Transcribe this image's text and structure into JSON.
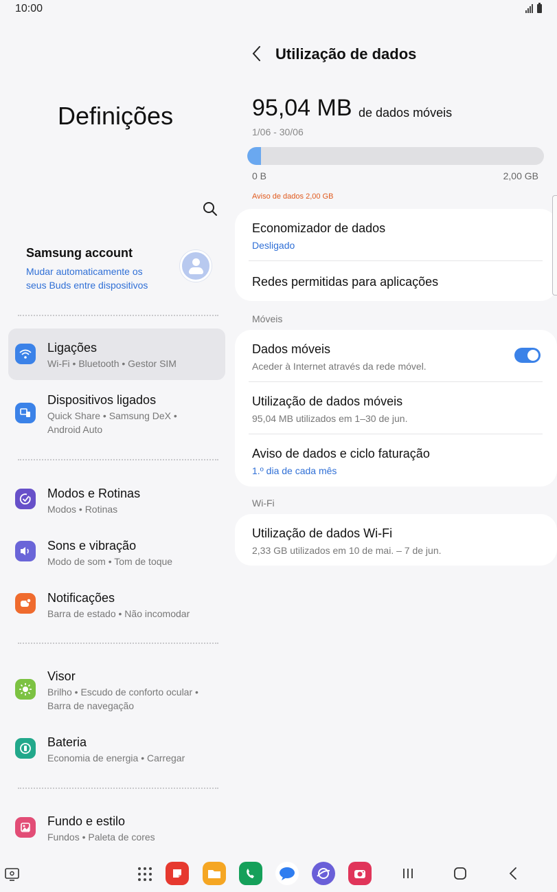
{
  "status": {
    "time": "10:00"
  },
  "left": {
    "title": "Definições",
    "account": {
      "name": "Samsung account",
      "subtitle": "Mudar automaticamente os seus Buds entre dispositivos"
    },
    "items": [
      {
        "label": "Ligações",
        "sub": "Wi-Fi • Bluetooth • Gestor SIM",
        "icon": "wifi-icon",
        "color": "#3b82e8"
      },
      {
        "label": "Dispositivos ligados",
        "sub": "Quick Share • Samsung DeX • Android Auto",
        "icon": "devices-icon",
        "color": "#3b82e8"
      },
      {
        "label": "Modos e Rotinas",
        "sub": "Modos • Rotinas",
        "icon": "check-circle-icon",
        "color": "#6750c9"
      },
      {
        "label": "Sons e vibração",
        "sub": "Modo de som • Tom de toque",
        "icon": "speaker-icon",
        "color": "#6a65d8"
      },
      {
        "label": "Notificações",
        "sub": "Barra de estado • Não incomodar",
        "icon": "notification-icon",
        "color": "#ef6b2e"
      },
      {
        "label": "Visor",
        "sub": "Brilho • Escudo de conforto ocular • Barra de navegação",
        "icon": "sun-icon",
        "color": "#7cc242"
      },
      {
        "label": "Bateria",
        "sub": "Economia de energia • Carregar",
        "icon": "battery-icon",
        "color": "#22a88b"
      },
      {
        "label": "Fundo e estilo",
        "sub": "Fundos • Paleta de cores",
        "icon": "palette-icon",
        "color": "#e24d76"
      }
    ]
  },
  "right": {
    "title": "Utilização de dados",
    "usage": {
      "amount": "95,04 MB",
      "unit": "de dados móveis",
      "period": "1/06 - 30/06",
      "fraction": 0.046,
      "min_label": "0 B",
      "max_label": "2,00 GB",
      "warning": "Aviso de dados 2,00 GB"
    },
    "card1": {
      "saver_title": "Economizador de dados",
      "saver_state": "Desligado",
      "allowed_title": "Redes permitidas para aplicações"
    },
    "mobile": {
      "section": "Móveis",
      "data_title": "Dados móveis",
      "data_sub": "Aceder à Internet através da rede móvel.",
      "data_enabled": true,
      "usage_title": "Utilização de dados móveis",
      "usage_sub": "95,04 MB utilizados em 1–30 de jun.",
      "cycle_title": "Aviso de dados e ciclo faturação",
      "cycle_sub": "1.º dia de cada mês"
    },
    "wifi": {
      "section": "Wi-Fi",
      "usage_title": "Utilização de dados Wi-Fi",
      "usage_sub": "2,33 GB utilizados em 10 de mai. – 7 de jun."
    }
  },
  "colors": {
    "accent": "#3b82e8",
    "link": "#2f6fd6",
    "warning": "#e05a1e"
  },
  "dock": [
    {
      "icon": "notes-app-icon",
      "color": "#e6392f"
    },
    {
      "icon": "files-app-icon",
      "color": "#f5a623"
    },
    {
      "icon": "phone-app-icon",
      "color": "#15a05a"
    },
    {
      "icon": "messages-app-icon",
      "color": "#2f7df0"
    },
    {
      "icon": "internet-app-icon",
      "color": "#6a5fd8"
    },
    {
      "icon": "camera-app-icon",
      "color": "#e0355a"
    }
  ]
}
